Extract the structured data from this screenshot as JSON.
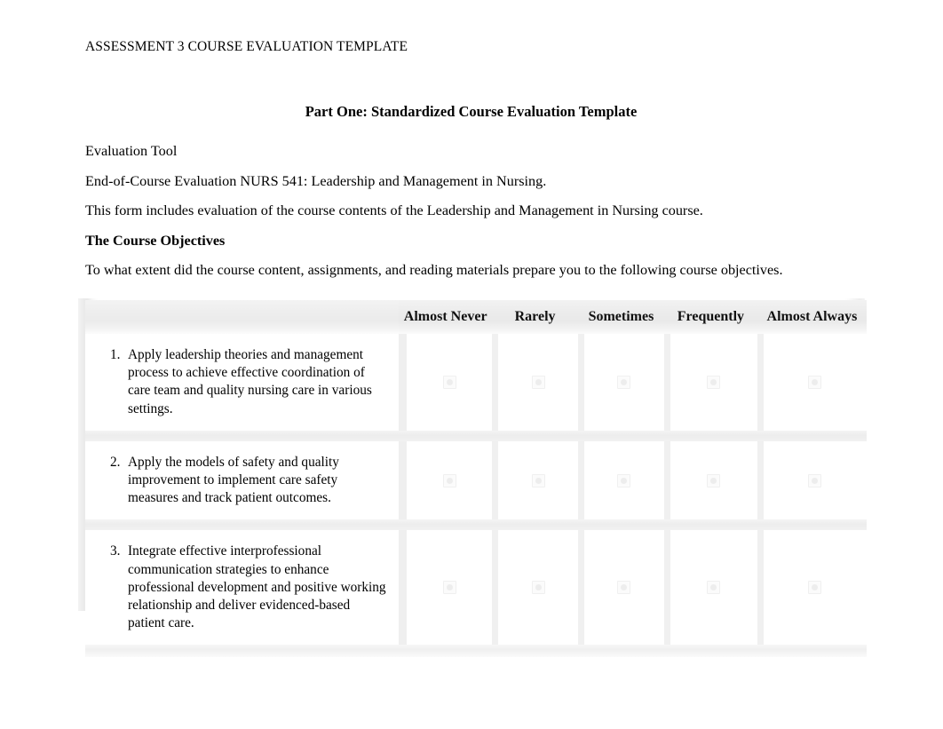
{
  "document": {
    "running_header": "ASSESSMENT 3 COURSE EVALUATION TEMPLATE",
    "part_title": "Part One: Standardized Course Evaluation Template",
    "paragraphs": [
      "Evaluation Tool",
      "End-of-Course Evaluation NURS 541: Leadership and Management in Nursing.",
      "This form includes evaluation of the course contents of the Leadership and Management in Nursing course."
    ],
    "section_heading": "The Course Objectives",
    "lead_in": "To what extent did the course content, assignments, and reading materials prepare you to the following course objectives."
  },
  "table": {
    "objective_column_header": "",
    "scale_headers": [
      "Almost Never",
      "Rarely",
      "Sometimes",
      "Frequently",
      "Almost Always"
    ],
    "rows": [
      {
        "number": "1.",
        "text": "Apply leadership theories and management process to achieve effective coordination of care team and quality nursing care in various settings.",
        "selected": null
      },
      {
        "number": "2.",
        "text": "Apply the models of safety and quality improvement to implement care safety measures and track patient outcomes.",
        "selected": null
      },
      {
        "number": "3.",
        "text": "Integrate effective interprofessional communication strategies to enhance professional development and positive working relationship and deliver evidenced-based patient care.",
        "selected": null
      }
    ],
    "control_type": "radio-button"
  },
  "colors": {
    "page_background": "#ffffff",
    "text": "#000000",
    "header_row_background": "#ececec",
    "cell_background": "#ffffff",
    "gutter": "#f0f0f0",
    "control_outline": "#ededed"
  }
}
